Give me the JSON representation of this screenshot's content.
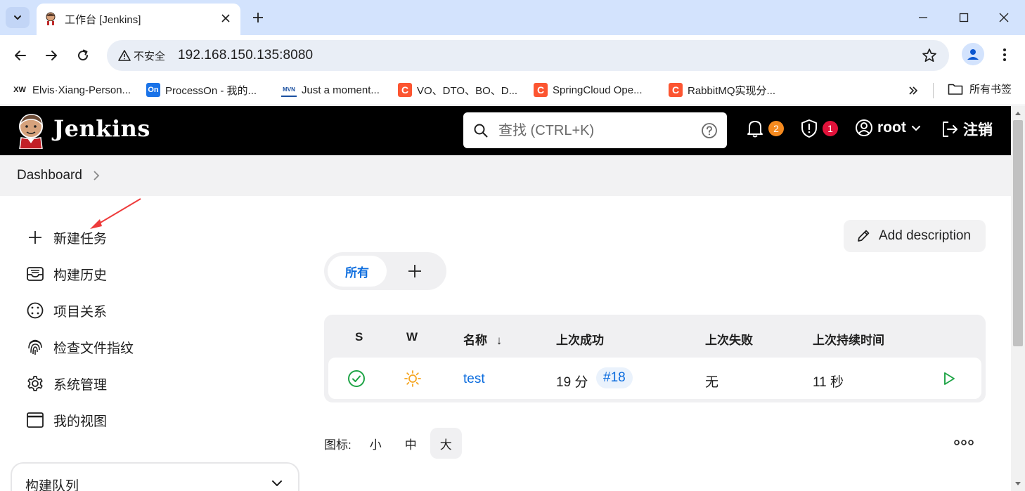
{
  "browser": {
    "tab": {
      "title": "工作台 [Jenkins]"
    },
    "address": {
      "security_label": "不安全",
      "url": "192.168.150.135:8080"
    },
    "bookmarks": [
      {
        "icon_text": "XW",
        "label": "Elvis·Xiang-Person..."
      },
      {
        "icon_text": "On",
        "label": "ProcessOn - 我的..."
      },
      {
        "icon_text": "MVN",
        "label": "Just a moment..."
      },
      {
        "icon_text": "C",
        "label": "VO、DTO、BO、D..."
      },
      {
        "icon_text": "C",
        "label": "SpringCloud Ope..."
      },
      {
        "icon_text": "C",
        "label": "RabbitMQ实现分..."
      }
    ],
    "all_bookmarks_label": "所有书签",
    "colors": {
      "tab_strip": "#d3e3fd",
      "omnibox": "#e9eef6"
    }
  },
  "header": {
    "brand": "Jenkins",
    "search_placeholder": "查找 (CTRL+K)",
    "notifications_count": "2",
    "security_count": "1",
    "user": "root",
    "logout_label": "注销",
    "colors": {
      "notification_badge": "#f58a1f",
      "security_badge": "#e2123a"
    }
  },
  "breadcrumb": {
    "items": [
      "Dashboard"
    ]
  },
  "sidebar": {
    "items": [
      {
        "label": "新建任务",
        "icon": "plus-icon"
      },
      {
        "label": "构建历史",
        "icon": "inbox-icon"
      },
      {
        "label": "项目关系",
        "icon": "relation-icon"
      },
      {
        "label": "检查文件指纹",
        "icon": "fingerprint-icon"
      },
      {
        "label": "系统管理",
        "icon": "gear-icon"
      },
      {
        "label": "我的视图",
        "icon": "window-icon"
      }
    ],
    "build_queue_label": "构建队列"
  },
  "main": {
    "add_description_label": "Add description",
    "view_tabs": [
      {
        "label": "所有",
        "active": true
      }
    ],
    "table": {
      "headers": [
        "S",
        "W",
        "名称",
        "上次成功",
        "上次失败",
        "上次持续时间"
      ],
      "sort_indicator": "↓",
      "rows": [
        {
          "status": "success",
          "weather": "sunny",
          "name": "test",
          "last_success_time": "19 分",
          "last_success_build": "#18",
          "last_failure": "无",
          "last_duration": "11 秒"
        }
      ]
    },
    "icon_size": {
      "label": "图标:",
      "options": [
        "小",
        "中",
        "大"
      ],
      "selected": "大"
    },
    "accent_color": "#0b6cde",
    "success_color": "#1ea446",
    "sunny_color": "#f5a623"
  }
}
